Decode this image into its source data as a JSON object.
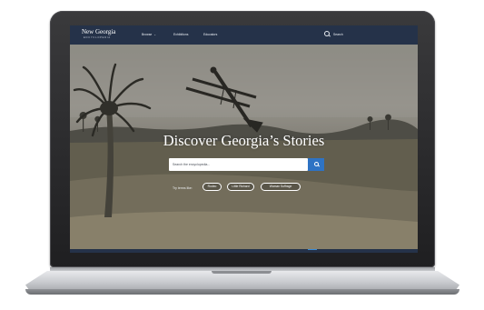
{
  "site": {
    "logo_title": "New Georgia",
    "logo_subtitle": "ENCYCLOPEDIA"
  },
  "nav": {
    "items": [
      {
        "label": "Browse",
        "has_dropdown": true
      },
      {
        "label": "Exhibitions"
      },
      {
        "label": "Educators"
      }
    ],
    "search_label": "Search"
  },
  "hero": {
    "title": "Discover Georgia’s Stories",
    "search_placeholder": "Search the encyclopedia...",
    "try_label": "Try terms like:",
    "suggestions": [
      "Rodeo",
      "Little Richard",
      "Woman Suffrage"
    ]
  },
  "colors": {
    "nav_bg": "#253249",
    "search_button": "#2e73c4",
    "accent": "#3a8bd6"
  },
  "icons": [
    "search-icon",
    "chevron-down-icon"
  ]
}
